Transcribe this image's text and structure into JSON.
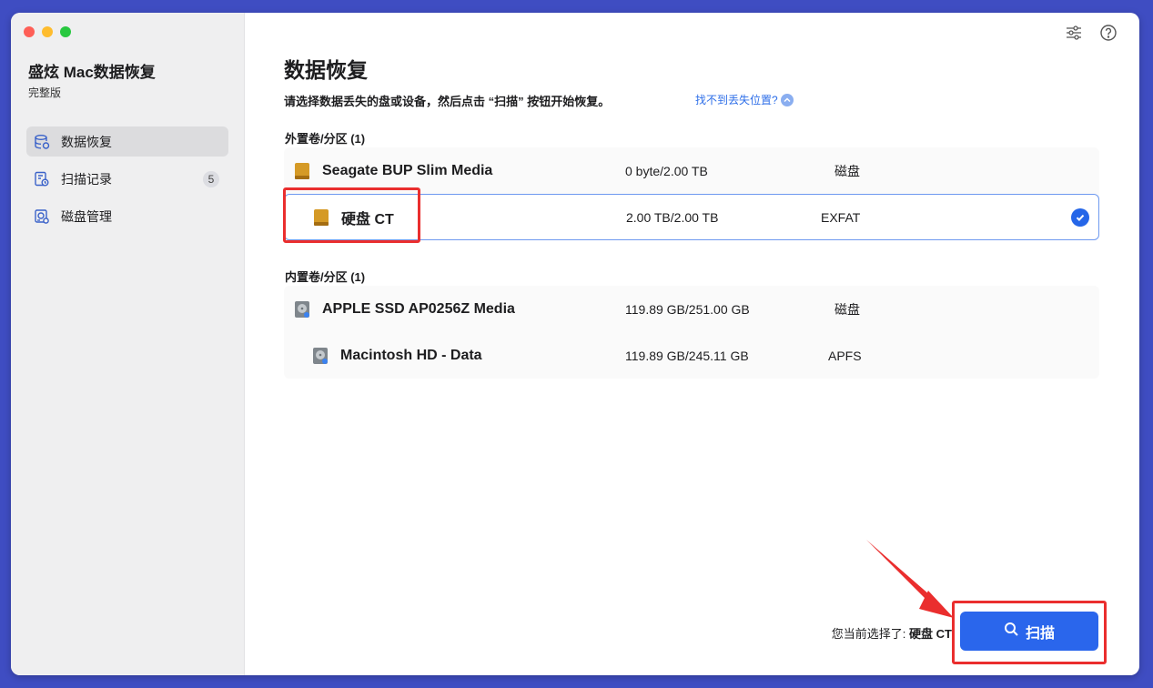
{
  "app": {
    "title": "盛炫 Mac数据恢复",
    "edition": "完整版"
  },
  "sidebar": {
    "items": [
      {
        "label": "数据恢复",
        "icon": "database-icon",
        "active": true
      },
      {
        "label": "扫描记录",
        "icon": "scan-history-icon",
        "badge": "5"
      },
      {
        "label": "磁盘管理",
        "icon": "disk-management-icon"
      }
    ]
  },
  "toolbar": {
    "icons": [
      "settings-sliders-icon",
      "help-icon"
    ]
  },
  "main": {
    "title": "数据恢复",
    "subtitle": "请选择数据丢失的盘或设备，然后点击 “扫描” 按钮开始恢复。",
    "help_link": "找不到丢失位置?",
    "external": {
      "label": "外置卷/分区 (1)",
      "disks": [
        {
          "name": "Seagate BUP Slim Media",
          "size": "0 byte/2.00 TB",
          "fs": "磁盘",
          "icon": "external-drive-icon"
        },
        {
          "name": "硬盘 CT",
          "size": "2.00 TB/2.00 TB",
          "fs": "EXFAT",
          "icon": "external-drive-icon",
          "selected": true
        }
      ]
    },
    "internal": {
      "label": "内置卷/分区 (1)",
      "disks": [
        {
          "name": "APPLE SSD AP0256Z Media",
          "size": "119.89 GB/251.00 GB",
          "fs": "磁盘",
          "icon": "internal-drive-icon"
        },
        {
          "name": "Macintosh HD - Data",
          "size": "119.89 GB/245.11 GB",
          "fs": "APFS",
          "icon": "internal-drive-icon"
        }
      ]
    }
  },
  "footer": {
    "selection_prefix": "您当前选择了:",
    "selection_value": "硬盘 CT",
    "scan_label": "扫描"
  },
  "colors": {
    "accent": "#2a66ec",
    "annotation": "#ea2e2e",
    "background": "#3f4dc2"
  }
}
